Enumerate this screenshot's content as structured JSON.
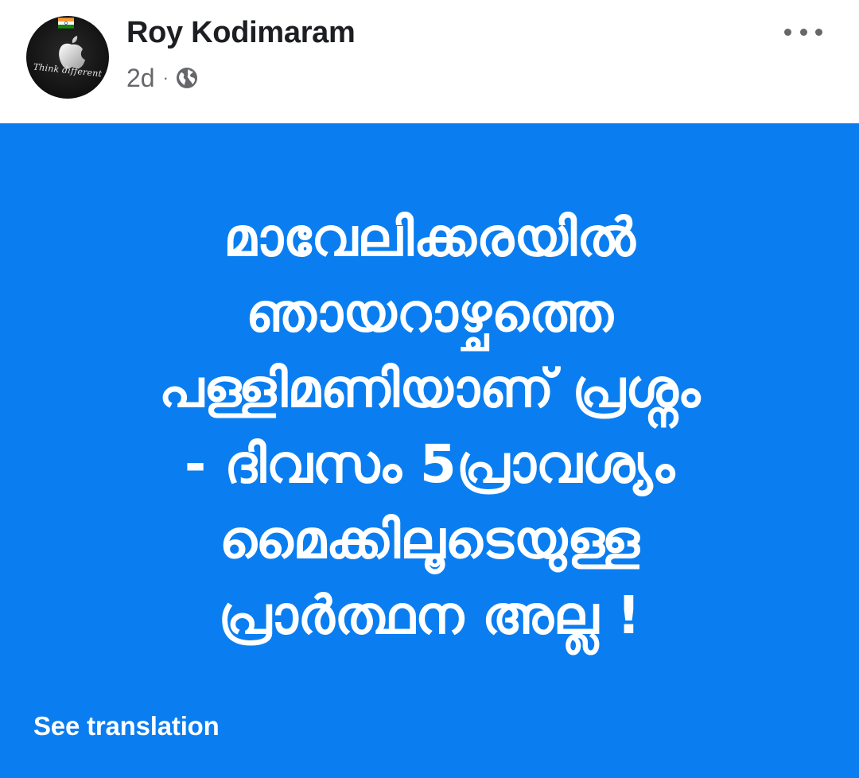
{
  "author": {
    "name": "Roy Kodimaram",
    "avatar_caption": "Think different",
    "avatar_icon": "apple-logo-icon",
    "flag_icon": "india-flag-icon"
  },
  "meta": {
    "time": "2d",
    "separator": "·",
    "audience_icon": "globe-icon"
  },
  "menu": {
    "more_icon": "more-options-icon"
  },
  "post": {
    "background_color": "#0a7ef0",
    "text_color": "#ffffff",
    "lines": [
      "മാവേലിക്കരയിൽ",
      "ഞായറാഴ്ചത്തെ",
      "പള്ളിമണിയാണ് പ്രശ്നം",
      "- ദിവസം 5പ്രാവശ്യം",
      "മൈക്കിലൂടെയുള്ള",
      "പ്രാർത്ഥന അല്ല !"
    ]
  },
  "footer": {
    "see_translation": "See translation"
  }
}
